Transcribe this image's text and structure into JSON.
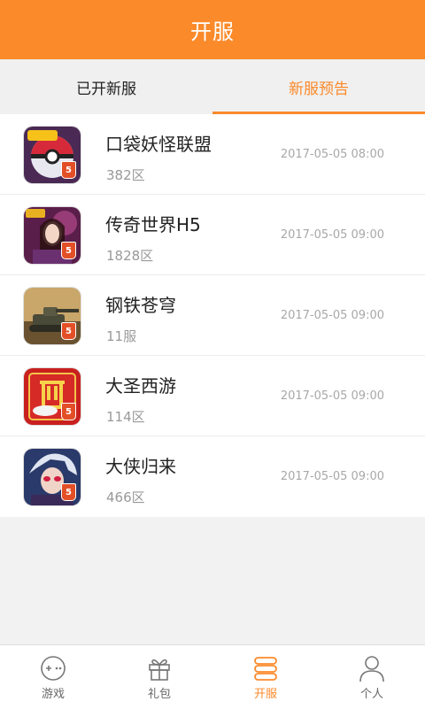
{
  "header": {
    "title": "开服"
  },
  "tabs": [
    {
      "label": "已开新服",
      "active": false
    },
    {
      "label": "新服预告",
      "active": true
    }
  ],
  "servers": [
    {
      "name": "口袋妖怪联盟",
      "zone": "382区",
      "time": "2017-05-05 08:00",
      "badge": "5"
    },
    {
      "name": "传奇世界H5",
      "zone": "1828区",
      "time": "2017-05-05 09:00",
      "badge": "5"
    },
    {
      "name": "钢铁苍穹",
      "zone": "11服",
      "time": "2017-05-05 09:00",
      "badge": "5"
    },
    {
      "name": "大圣西游",
      "zone": "114区",
      "time": "2017-05-05 09:00",
      "badge": "5"
    },
    {
      "name": "大侠归来",
      "zone": "466区",
      "time": "2017-05-05 09:00",
      "badge": "5"
    }
  ],
  "nav": [
    {
      "label": "游戏",
      "icon": "gamepad-icon",
      "active": false
    },
    {
      "label": "礼包",
      "icon": "gift-icon",
      "active": false
    },
    {
      "label": "开服",
      "icon": "server-stack-icon",
      "active": true
    },
    {
      "label": "个人",
      "icon": "person-icon",
      "active": false
    }
  ],
  "colors": {
    "accent": "#fb8a2a",
    "inactive": "#666666"
  }
}
